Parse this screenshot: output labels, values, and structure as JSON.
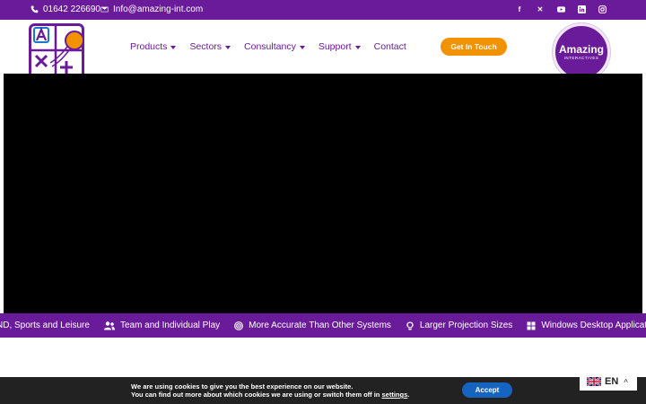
{
  "topbar": {
    "phone": "01642 226690",
    "email": "Info@amazing-int.com",
    "socials": [
      "facebook-icon",
      "x-icon",
      "youtube-icon",
      "linkedin-icon",
      "instagram-icon"
    ]
  },
  "header": {
    "nav": [
      {
        "label": "Products"
      },
      {
        "label": "Sectors"
      },
      {
        "label": "Consultancy"
      },
      {
        "label": "Support"
      },
      {
        "label": "Contact"
      }
    ],
    "cta_label": "Get In Touch",
    "brand_name": "Amazing",
    "brand_sub": "INTERACTIVES"
  },
  "ticker": {
    "items": [
      "ND, Sports and Leisure",
      "Team and Individual Play",
      "More Accurate Than Other Systems",
      "Larger Projection Sizes",
      "Windows Desktop Application Tracking"
    ]
  },
  "cookie": {
    "line1": "We are using cookies to give you the best experience on our website.",
    "line2_prefix": "You can find out more about which cookies we are using or switch them off in ",
    "settings_link": "settings",
    "line2_suffix": ".",
    "accept_label": "Accept"
  },
  "language": {
    "code": "EN"
  },
  "colors": {
    "brand": "#6a1b9a",
    "accent": "#f39200",
    "accept": "#1565c0",
    "cookie_bg": "#222222"
  }
}
